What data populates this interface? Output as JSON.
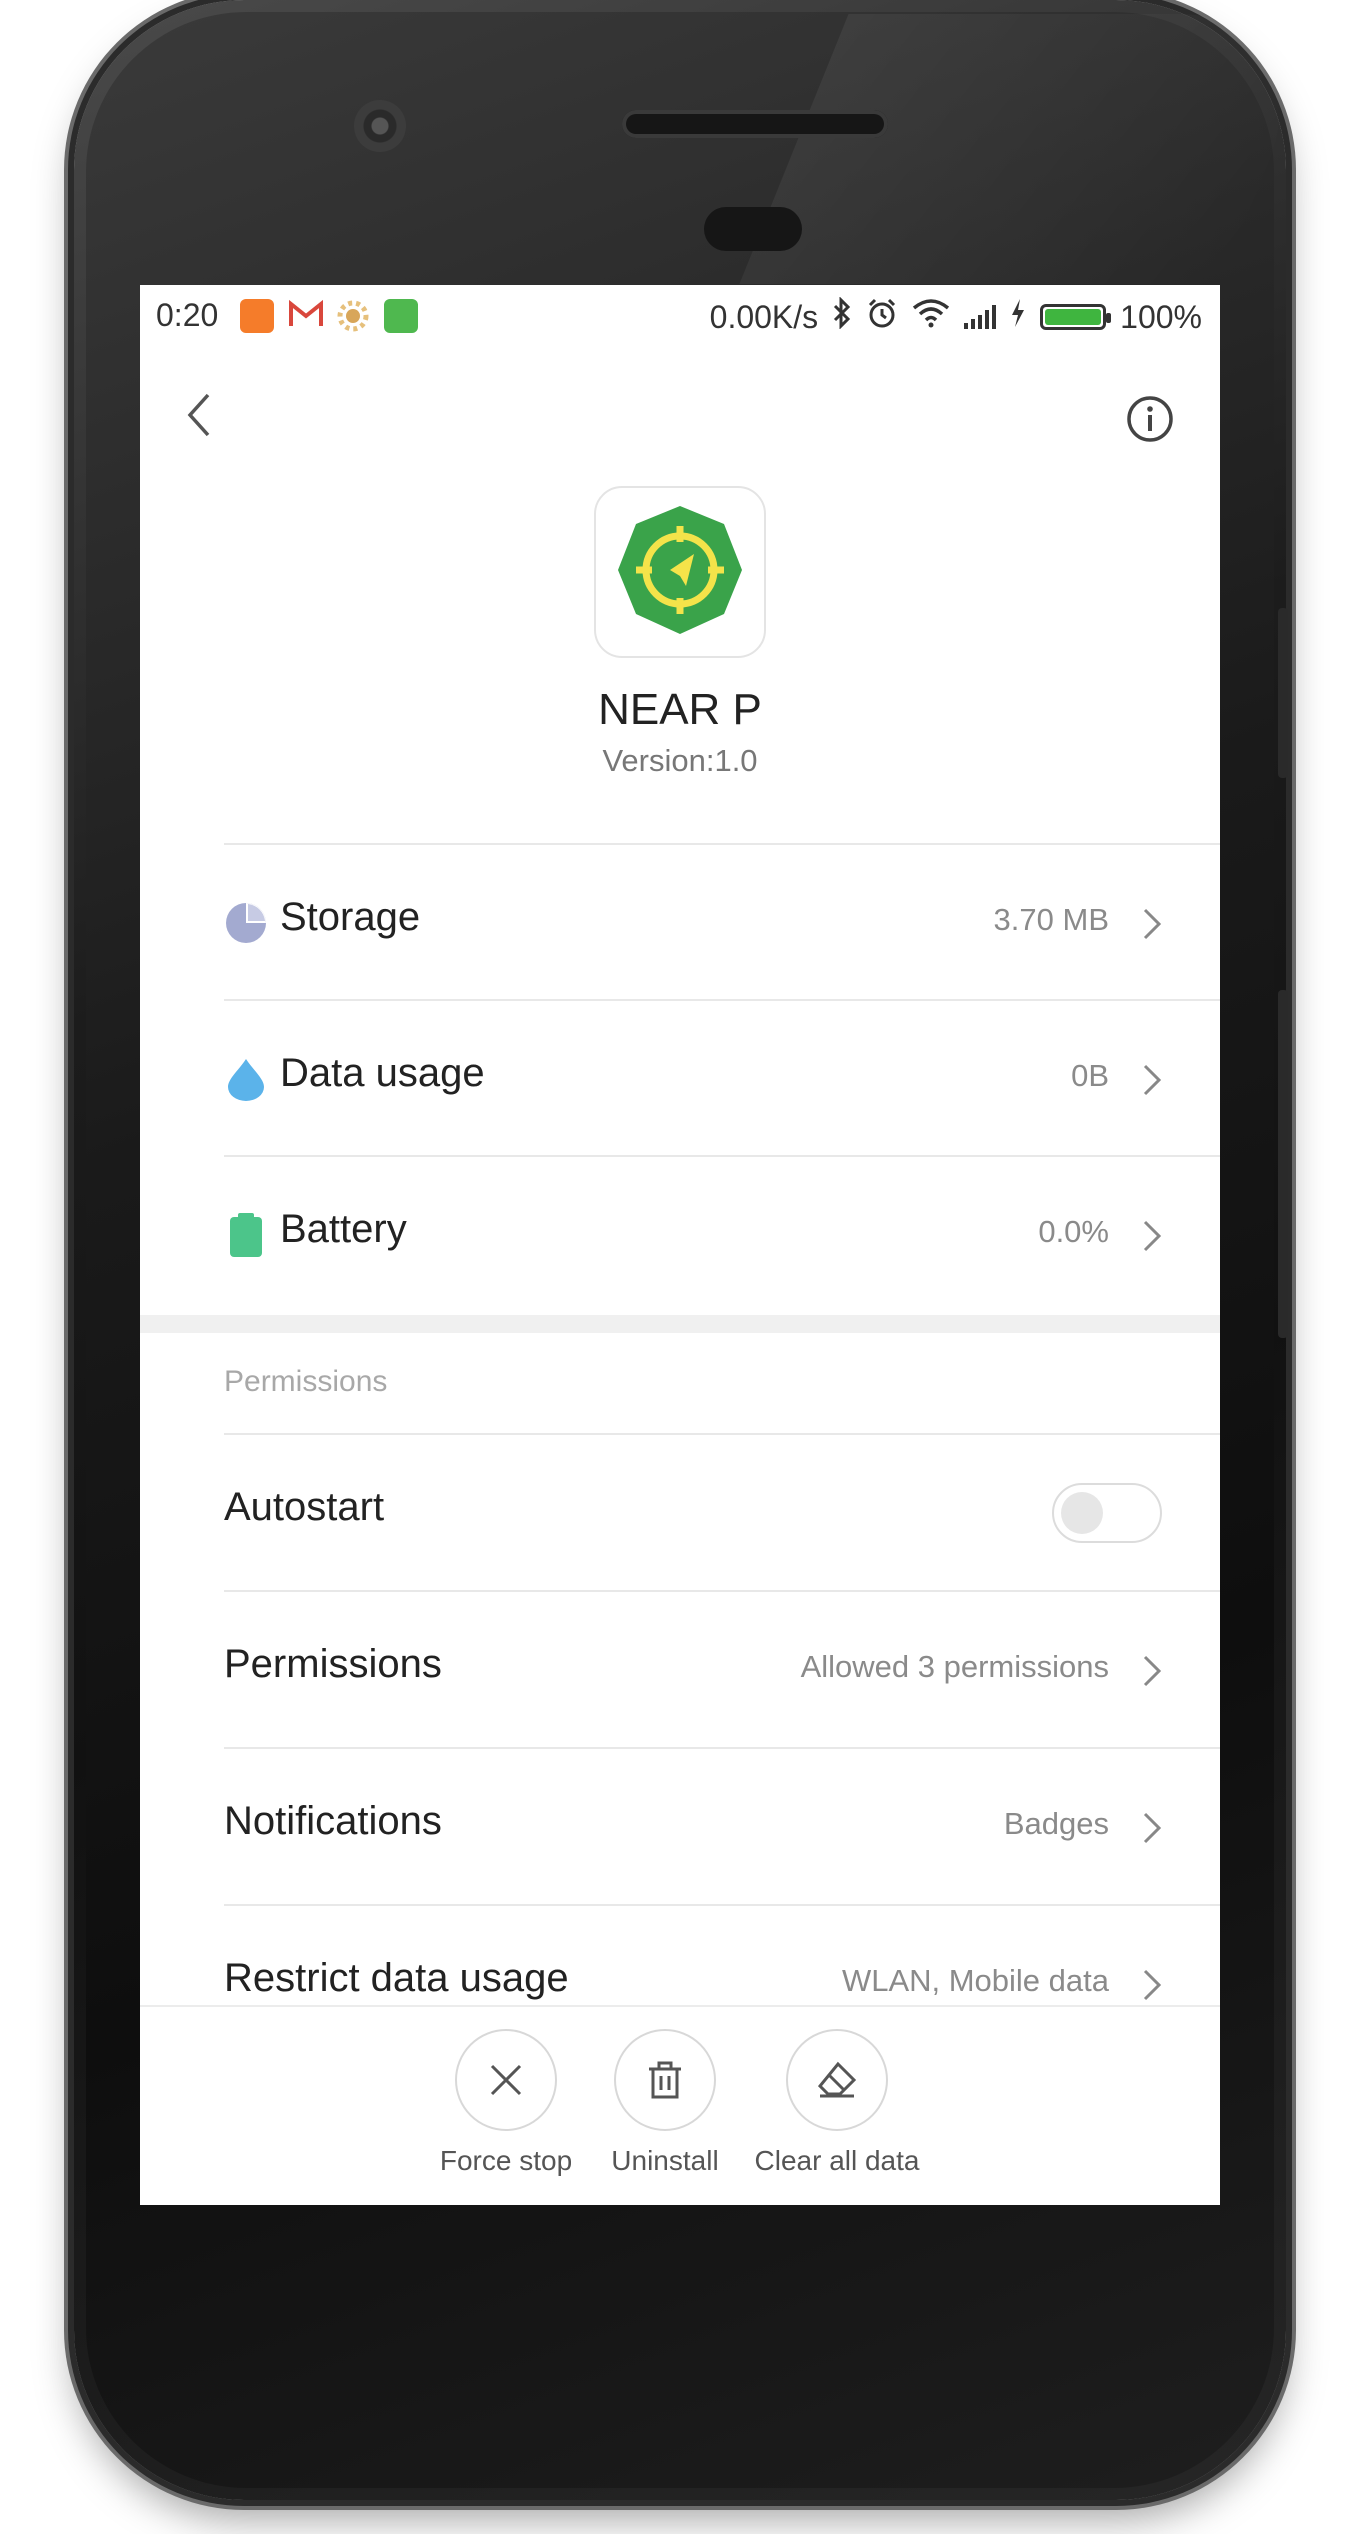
{
  "status_bar": {
    "time": "0:20",
    "network_speed": "0.00K/s",
    "battery_percent": "100%",
    "battery_level": 1.0,
    "notification_icons": [
      "mi-icon",
      "gmail-icon",
      "flower-icon",
      "cat-icon"
    ],
    "system_icons": [
      "bluetooth-icon",
      "alarm-icon",
      "wifi-icon",
      "signal-icon",
      "charging-icon"
    ]
  },
  "header": {
    "back_icon": "chevron-left-icon",
    "info_icon": "info-icon"
  },
  "app": {
    "name": "NEAR P",
    "version": "Version:1.0",
    "icon": "compass-target-icon",
    "icon_color": "#3aa34a"
  },
  "usage_rows": [
    {
      "label": "Storage",
      "value": "3.70 MB",
      "icon": "pie-chart-icon",
      "color": "#a3aad0"
    },
    {
      "label": "Data usage",
      "value": "0B",
      "icon": "water-drop-icon",
      "color": "#5bb3ea"
    },
    {
      "label": "Battery",
      "value": "0.0%",
      "icon": "battery-icon",
      "color": "#4cc58a"
    }
  ],
  "permissions_section": {
    "title": "Permissions",
    "autostart": {
      "label": "Autostart",
      "enabled": false
    },
    "rows": [
      {
        "label": "Permissions",
        "value": "Allowed 3 permissions"
      },
      {
        "label": "Notifications",
        "value": "Badges"
      },
      {
        "label": "Restrict data usage",
        "value": "WLAN, Mobile data"
      }
    ]
  },
  "actions": [
    {
      "label": "Force stop",
      "icon": "close-icon"
    },
    {
      "label": "Uninstall",
      "icon": "trash-icon"
    },
    {
      "label": "Clear all data",
      "icon": "eraser-icon"
    }
  ]
}
